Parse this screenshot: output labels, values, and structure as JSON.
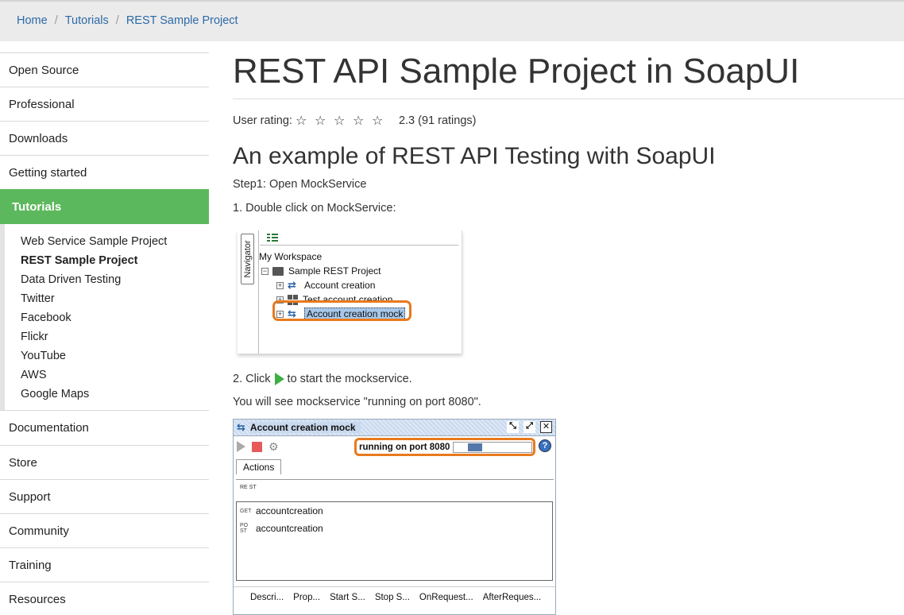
{
  "breadcrumb": {
    "items": [
      "Home",
      "Tutorials",
      "REST Sample Project"
    ],
    "separator": "/"
  },
  "sidebar": {
    "top_items": [
      "Open Source",
      "Professional",
      "Downloads",
      "Getting started"
    ],
    "active_item": "Tutorials",
    "sub_items": [
      "Web Service Sample Project",
      "REST Sample Project",
      "Data Driven Testing",
      "Twitter",
      "Facebook",
      "Flickr",
      "YouTube",
      "AWS",
      "Google Maps"
    ],
    "current_sub_item": "REST Sample Project",
    "bottom_items": [
      "Documentation",
      "Store",
      "Support",
      "Community",
      "Training",
      "Resources"
    ],
    "active_color": "#5cb85c"
  },
  "main": {
    "title": "REST API Sample Project in SoapUI",
    "rating_label": "User rating:",
    "rating_stars": 5,
    "rating_value": "2.3 (91 ratings)",
    "subtitle": "An example of REST API Testing with SoapUI",
    "step1": "Step1: Open MockService",
    "step1_instruction": "1. Double click on MockService:",
    "step2_click": "2. Click",
    "step2_rest": "to start the mockservice.",
    "step2_note": "You will see mockservice \"running on port 8080\"."
  },
  "navigator_shot": {
    "tab_label": "Navigator",
    "workspace": "My Workspace",
    "project": "Sample REST Project",
    "items": [
      "Account creation",
      "Test account creation",
      "Account creation mock"
    ],
    "selected": "Account creation mock",
    "highlight_color": "#e87a1e"
  },
  "mock_shot": {
    "title": "Account creation mock",
    "status": "running on port 8080",
    "help": "?",
    "tab": "Actions",
    "rest_icon": "RE ST",
    "resources": [
      {
        "method": "GET",
        "path": "accountcreation"
      },
      {
        "method": "PO ST",
        "path": "accountcreation"
      }
    ],
    "bottom_tabs": [
      "Descri...",
      "Prop...",
      "Start S...",
      "Stop S...",
      "OnRequest...",
      "AfterReques..."
    ]
  }
}
